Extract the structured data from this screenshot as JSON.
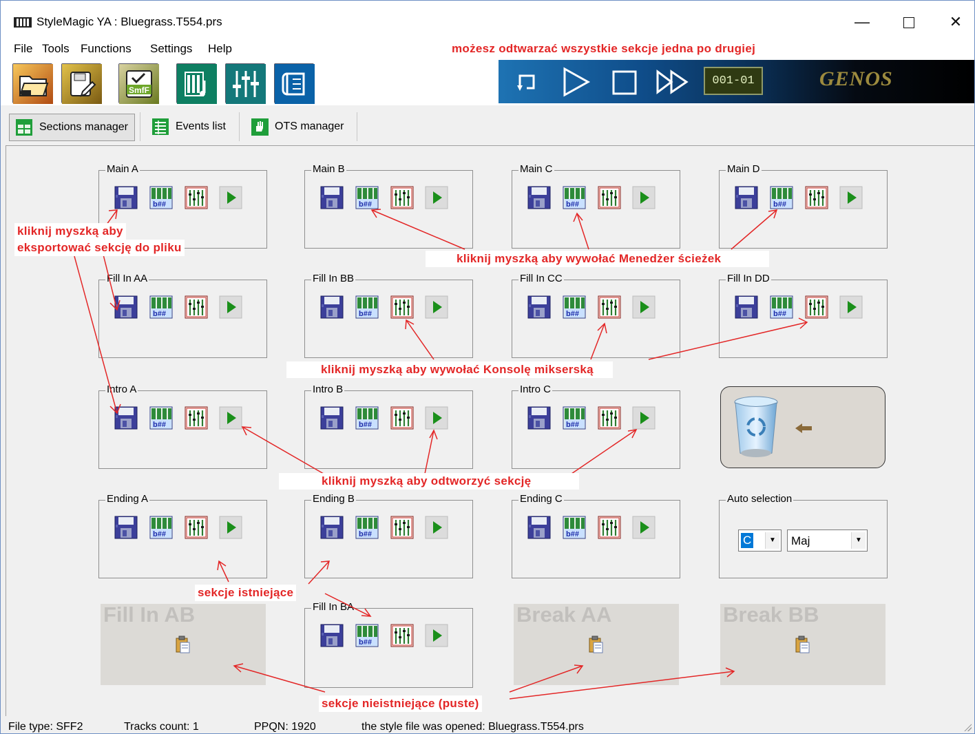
{
  "window": {
    "title": "StyleMagic YA : Bluegrass.T554.prs"
  },
  "menu": [
    {
      "label": "File"
    },
    {
      "label": "Tools"
    },
    {
      "label": "Functions"
    },
    {
      "label": "Settings"
    },
    {
      "label": "Help"
    }
  ],
  "toolbar": {
    "buttons": [
      "open-style-icon",
      "save-style-icon",
      "smf-export-icon",
      "tracks-editor-icon",
      "mixer-icon",
      "notes-icon"
    ],
    "player": {
      "position": "001-01",
      "brand": "GENOS"
    }
  },
  "tabs": [
    {
      "label": "Sections manager",
      "active": true
    },
    {
      "label": "Events list",
      "active": false
    },
    {
      "label": "OTS manager",
      "active": false
    }
  ],
  "sections": {
    "main_a": "Main A",
    "main_b": "Main B",
    "main_c": "Main C",
    "main_d": "Main D",
    "fill_aa": "Fill In AA",
    "fill_bb": "Fill In BB",
    "fill_cc": "Fill In CC",
    "fill_dd": "Fill In DD",
    "intro_a": "Intro A",
    "intro_b": "Intro B",
    "intro_c": "Intro C",
    "ending_a": "Ending A",
    "ending_b": "Ending B",
    "ending_c": "Ending C",
    "fill_ba": "Fill In BA"
  },
  "empty_sections": {
    "fill_ab": "Fill In AB",
    "break_aa": "Break AA",
    "break_bb": "Break BB"
  },
  "auto_selection": {
    "label": "Auto selection",
    "key": "C",
    "scale": "Maj"
  },
  "annotations": {
    "player_note": "możesz odtwarzać wszystkie sekcje jedna po drugiej",
    "export_line1": "kliknij myszką aby",
    "export_line2": "eksportować sekcję do pliku",
    "tracks_note": "kliknij myszką aby wywołać Menedżer ścieżek",
    "mixer_note": "kliknij myszką aby wywołać Konsolę mikserską",
    "play_note": "kliknij myszką aby odtworzyć sekcję",
    "existing_note": "sekcje istniejące",
    "empty_note": "sekcje nieistniejące (puste)"
  },
  "status": {
    "file_type": "File type: SFF2",
    "tracks": "Tracks count: 1",
    "ppqn": "PPQN: 1920",
    "message": "the style file was opened: Bluegrass.T554.prs"
  },
  "colors": {
    "annotation": "#e32626",
    "selection": "#0078d7",
    "player_left": "#1e73b3"
  }
}
